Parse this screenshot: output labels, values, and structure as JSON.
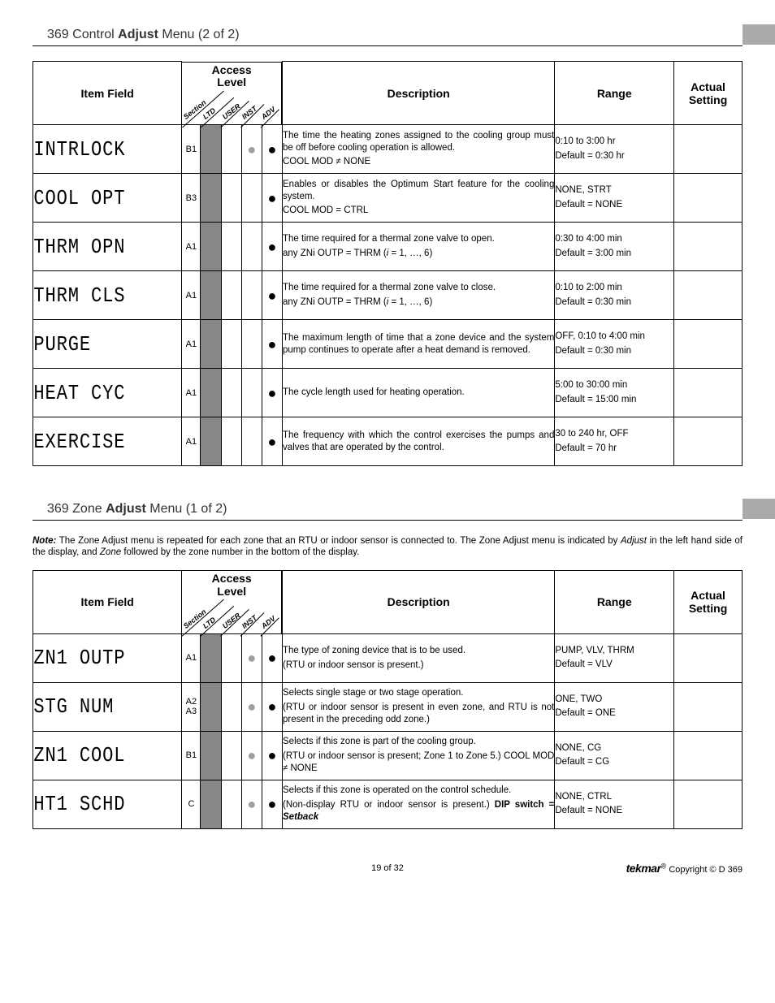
{
  "section1": {
    "title_prefix": "369 Control ",
    "title_bold": "Adjust",
    "title_suffix": " Menu (2 of 2)"
  },
  "section2": {
    "title_prefix": "369 Zone ",
    "title_bold": "Adjust",
    "title_suffix": " Menu (1 of 2)"
  },
  "headers": {
    "item_field": "Item Field",
    "access_level_line1": "Access",
    "access_level_line2": "Level",
    "description": "Description",
    "range": "Range",
    "actual_setting_line1": "Actual",
    "actual_setting_line2": "Setting",
    "rot_section": "Section",
    "rot_ltd": "LTD",
    "rot_user": "USER",
    "rot_inst": "INST",
    "rot_adv": "ADV"
  },
  "table1_rows": [
    {
      "item": "INTRLOCK",
      "section": "B1",
      "dots": {
        "user": false,
        "inst": "grey",
        "adv": "black"
      },
      "desc_lines": [
        "The time the heating zones assigned to the cooling group must be off before cooling operation is allowed.",
        "COOL MOD ≠ NONE"
      ],
      "range_lines": [
        "0:10 to 3:00 hr",
        "Default = 0:30 hr"
      ]
    },
    {
      "item": "COOL OPT",
      "section": "B3",
      "dots": {
        "user": false,
        "inst": false,
        "adv": "black"
      },
      "desc_lines": [
        "Enables or disables the Optimum Start feature for the cooling system.",
        "COOL MOD = CTRL"
      ],
      "range_lines": [
        "NONE, STRT",
        "Default = NONE"
      ]
    },
    {
      "item": "THRM OPN",
      "section": "A1",
      "dots": {
        "user": false,
        "inst": false,
        "adv": "black"
      },
      "desc_lines": [
        "The time required for a thermal zone valve to open.",
        "any ZNi OUTP = THRM (<i>i</i> = 1, …, 6)"
      ],
      "range_lines": [
        "0:30 to 4:00 min",
        "Default = 3:00 min"
      ]
    },
    {
      "item": "THRM CLS",
      "section": "A1",
      "dots": {
        "user": false,
        "inst": false,
        "adv": "black"
      },
      "desc_lines": [
        "The time required for a thermal zone valve to close.",
        "any ZNi OUTP = THRM (<i>i</i> = 1, …, 6)"
      ],
      "range_lines": [
        "0:10 to 2:00 min",
        "Default = 0:30 min"
      ]
    },
    {
      "item": "PURGE",
      "section": "A1",
      "dots": {
        "user": false,
        "inst": false,
        "adv": "black"
      },
      "desc_lines": [
        "The maximum length of time that a zone device and the system pump continues to operate after a heat demand is removed."
      ],
      "range_lines": [
        "OFF, 0:10 to 4:00 min",
        "Default = 0:30 min"
      ]
    },
    {
      "item": "HEAT CYC",
      "section": "A1",
      "dots": {
        "user": false,
        "inst": false,
        "adv": "black"
      },
      "desc_lines": [
        "The cycle length used for heating operation."
      ],
      "range_lines": [
        "5:00 to 30:00 min",
        "Default = 15:00 min"
      ]
    },
    {
      "item": "EXERCISE",
      "section": "A1",
      "dots": {
        "user": false,
        "inst": false,
        "adv": "black"
      },
      "desc_lines": [
        "The frequency with which the control exercises the pumps and valves that are operated by the control."
      ],
      "range_lines": [
        "30 to 240 hr, OFF",
        "Default = 70 hr"
      ]
    }
  ],
  "note": {
    "label": "Note:",
    "text_parts": [
      " The Zone Adjust menu is repeated for each zone that an RTU or indoor sensor is connected to. The Zone Adjust menu is indicated by ",
      "Adjust",
      " in the left hand side of the display, and ",
      "Zone",
      " followed by the zone number in the bottom of the display."
    ]
  },
  "table2_rows": [
    {
      "item": "ZN1 OUTP",
      "section": "A1",
      "dots": {
        "user": false,
        "inst": "grey",
        "adv": "black"
      },
      "desc_lines": [
        "The type of zoning device that is to be used.",
        "(RTU or indoor sensor is present.)"
      ],
      "range_lines": [
        "PUMP, VLV, THRM",
        "Default = VLV"
      ]
    },
    {
      "item": "STG NUM",
      "section": "A2\nA3",
      "dots": {
        "user": false,
        "inst": "grey",
        "adv": "black"
      },
      "desc_lines": [
        "Selects single stage or two stage operation.",
        "(RTU or indoor sensor is present in even zone, and RTU is not present in the preceding odd zone.)"
      ],
      "range_lines": [
        "ONE, TWO",
        "Default = ONE"
      ]
    },
    {
      "item": "ZN1 COOL",
      "section": "B1",
      "dots": {
        "user": false,
        "inst": "grey",
        "adv": "black"
      },
      "desc_lines": [
        "Selects if this zone is part of the cooling group.",
        "(RTU or indoor sensor is present; Zone 1 to Zone 5.) COOL MOD ≠ NONE"
      ],
      "range_lines": [
        "NONE, CG",
        "Default = CG"
      ]
    },
    {
      "item": "HT1 SCHD",
      "section": "C",
      "dots": {
        "user": false,
        "inst": "grey",
        "adv": "black"
      },
      "desc_lines": [
        "Selects if this zone is operated on the control schedule.",
        "(Non-display RTU or indoor sensor is present.) <b>DIP switch = <i>Setback</i></b>"
      ],
      "range_lines": [
        "NONE, CTRL",
        "Default = NONE"
      ]
    }
  ],
  "footer": {
    "page": "19 of 32",
    "brand": "tekmar",
    "copyright": " Copyright © D 369"
  }
}
